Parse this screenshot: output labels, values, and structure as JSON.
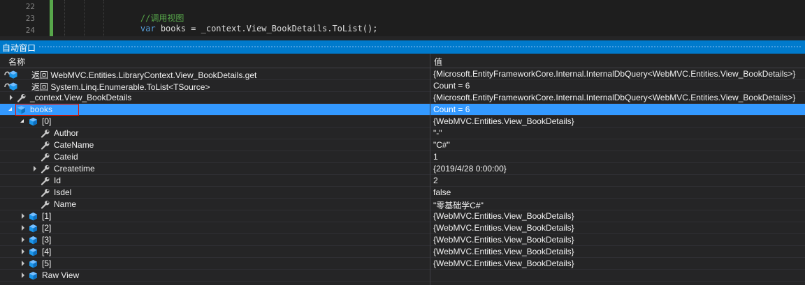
{
  "editor": {
    "lines": [
      {
        "num": "22",
        "code_comment": "//调用视图",
        "code_kw": "",
        "code_plain": ""
      },
      {
        "num": "23",
        "code_comment": "",
        "code_kw": "var",
        "code_plain": " books = _context.View_BookDetails.ToList();"
      },
      {
        "num": "24",
        "code_comment": "",
        "code_kw": "",
        "code_plain": ""
      }
    ]
  },
  "autos": {
    "title": "自动窗口",
    "columns": {
      "name": "名称",
      "value": "值"
    },
    "rows": [
      {
        "name": "返回 WebMVC.Entities.LibraryContext.View_BookDetails.get",
        "value": "{Microsoft.EntityFrameworkCore.Internal.InternalDbQuery<WebMVC.Entities.View_BookDetails>}",
        "icon": "return-value-icon"
      },
      {
        "name": "返回 System.Linq.Enumerable.ToList<TSource>",
        "value": "Count = 6",
        "icon": "return-value-icon"
      },
      {
        "name": "_context.View_BookDetails",
        "value": "{Microsoft.EntityFrameworkCore.Internal.InternalDbQuery<WebMVC.Entities.View_BookDetails>}",
        "icon": "property-wrench-icon"
      },
      {
        "name": "books",
        "value": "Count = 6",
        "icon": "local-variable-icon"
      },
      {
        "name": "[0]",
        "value": "{WebMVC.Entities.View_BookDetails}",
        "icon": "local-variable-icon"
      },
      {
        "name": "Author",
        "value": "\"-\"",
        "icon": "property-wrench-icon"
      },
      {
        "name": "CateName",
        "value": "\"C#\"",
        "icon": "property-wrench-icon"
      },
      {
        "name": "Cateid",
        "value": "1",
        "icon": "property-wrench-icon"
      },
      {
        "name": "Createtime",
        "value": "{2019/4/28 0:00:00}",
        "icon": "property-wrench-icon"
      },
      {
        "name": "Id",
        "value": "2",
        "icon": "property-wrench-icon"
      },
      {
        "name": "Isdel",
        "value": "false",
        "icon": "property-wrench-icon"
      },
      {
        "name": "Name",
        "value": "\"零基础学C#\"",
        "icon": "property-wrench-icon"
      },
      {
        "name": "[1]",
        "value": "{WebMVC.Entities.View_BookDetails}",
        "icon": "local-variable-icon"
      },
      {
        "name": "[2]",
        "value": "{WebMVC.Entities.View_BookDetails}",
        "icon": "local-variable-icon"
      },
      {
        "name": "[3]",
        "value": "{WebMVC.Entities.View_BookDetails}",
        "icon": "local-variable-icon"
      },
      {
        "name": "[4]",
        "value": "{WebMVC.Entities.View_BookDetails}",
        "icon": "local-variable-icon"
      },
      {
        "name": "[5]",
        "value": "{WebMVC.Entities.View_BookDetails}",
        "icon": "local-variable-icon"
      },
      {
        "name": "Raw View",
        "value": "",
        "icon": "local-variable-icon"
      }
    ]
  },
  "colors": {
    "accent": "#007acc",
    "selection": "#3399ff",
    "comment": "#57a64a",
    "keyword": "#569cd6"
  }
}
